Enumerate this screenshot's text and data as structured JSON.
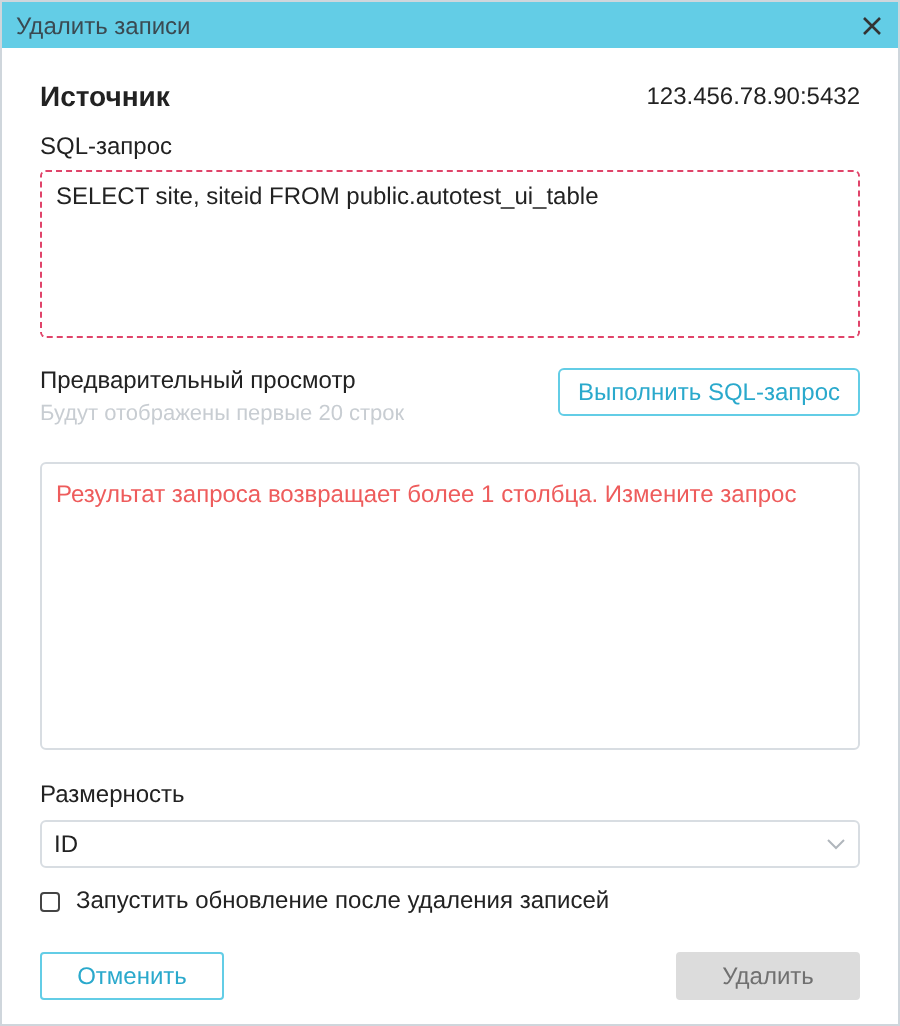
{
  "window": {
    "title": "Удалить записи"
  },
  "source": {
    "heading": "Источник",
    "address": "123.456.78.90:5432"
  },
  "sql": {
    "label": "SQL-запрос",
    "value": "SELECT site, siteid FROM public.autotest_ui_table",
    "invalid": true
  },
  "preview": {
    "title": "Предварительный просмотр",
    "hint": "Будут отображены первые 20 строк",
    "run_button": "Выполнить SQL-запрос",
    "error": "Результат запроса возвращает более 1 столбца. Измените запрос"
  },
  "dimension": {
    "label": "Размерность",
    "value": "ID"
  },
  "refresh_after_delete": {
    "label": "Запустить обновление после удаления записей",
    "checked": false
  },
  "buttons": [
    {
      "label": "Отменить",
      "kind": "secondary",
      "disabled": false
    },
    {
      "label": "Удалить",
      "kind": "primary",
      "disabled": true
    }
  ]
}
